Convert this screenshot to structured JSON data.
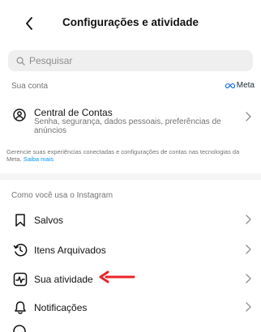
{
  "header": {
    "title": "Configurações e atividade"
  },
  "search": {
    "placeholder": "Pesquisar"
  },
  "account_section": {
    "label": "Sua conta",
    "meta_brand": "Meta",
    "central": {
      "title": "Central de Contas",
      "subtitle": "Senha, segurança, dados pessoais, preferências de anúncios"
    },
    "info_text": "Gerencie suas experiências conectadas e configurações de contas nas tecnologias da Meta.",
    "info_link": "Saiba mais"
  },
  "usage_section": {
    "label": "Como você usa o Instagram",
    "items": [
      {
        "label": "Salvos",
        "icon": "bookmark-icon"
      },
      {
        "label": "Itens Arquivados",
        "icon": "archive-clock-icon"
      },
      {
        "label": "Sua atividade",
        "icon": "activity-icon"
      },
      {
        "label": "Notificações",
        "icon": "bell-icon"
      }
    ]
  },
  "colors": {
    "accent_link": "#0095f6",
    "arrow": "#e8232a",
    "secondary_text": "#737373"
  }
}
